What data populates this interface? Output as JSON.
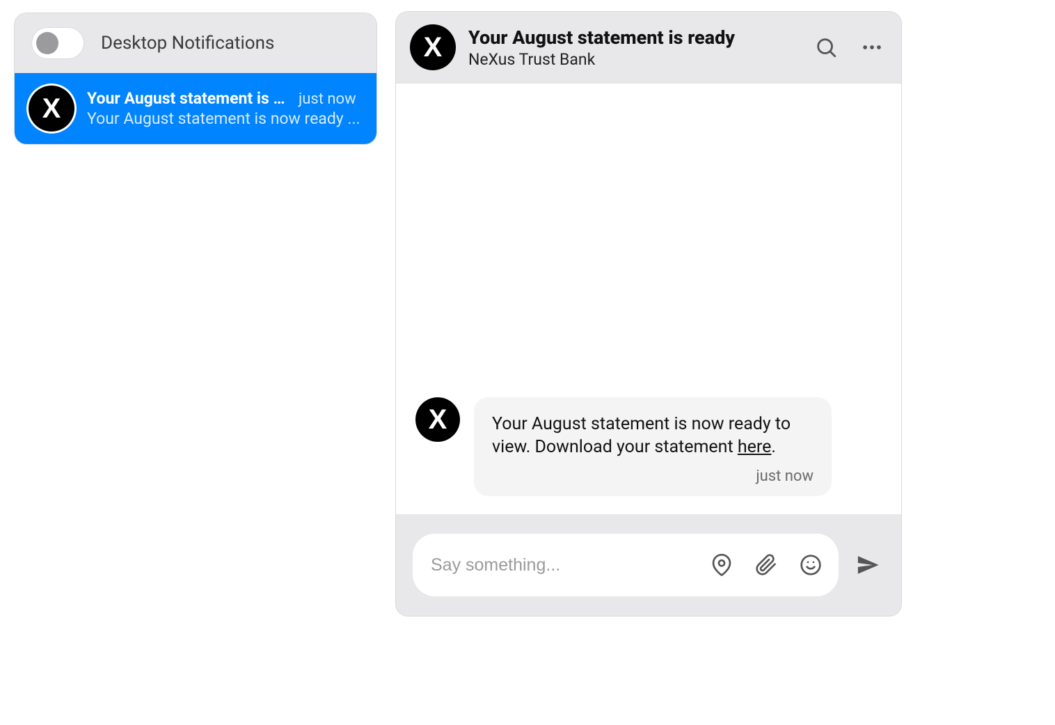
{
  "sidebar": {
    "toggle_label": "Desktop Notifications",
    "toggle_on": false,
    "items": [
      {
        "title": "Your August statement is r...",
        "time": "just now",
        "preview": "Your August statement is now ready ...",
        "avatar_letter": "X",
        "selected": true
      }
    ]
  },
  "chat": {
    "header": {
      "title": "Your August statement is ready",
      "subtitle": "NeXus Trust Bank",
      "avatar_letter": "X"
    },
    "messages": [
      {
        "avatar_letter": "X",
        "text_prefix": "Your August statement is now ready to view. Download your statement ",
        "link_text": "here",
        "text_suffix": ".",
        "time": "just now"
      }
    ],
    "composer": {
      "placeholder": "Say something..."
    }
  }
}
